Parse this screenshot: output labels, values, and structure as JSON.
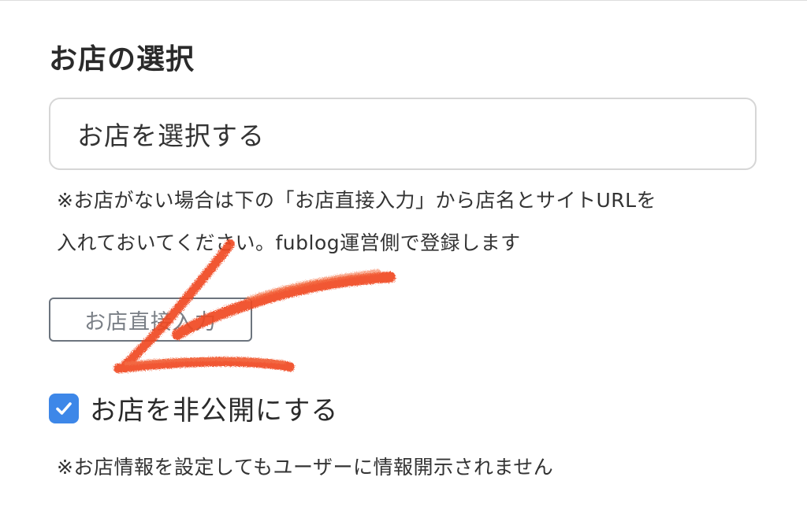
{
  "section": {
    "title": "お店の選択"
  },
  "shop_select": {
    "value": "お店を選択する"
  },
  "help": {
    "line1": "※お店がない場合は下の「お店直接入力」から店名とサイトURLを",
    "line2": "入れておいてください。fublog運営側で登録します"
  },
  "manual_entry": {
    "label": "お店直接入力"
  },
  "private_toggle": {
    "checked": true,
    "label": "お店を非公開にする"
  },
  "note": {
    "text": "※お店情報を設定してもユーザーに情報開示されません"
  },
  "annotation": {
    "type": "hand-drawn-arrow",
    "color": "#f04a24"
  },
  "colors": {
    "checkbox": "#3d87e8",
    "button_border": "#6c747e",
    "input_border": "#d6d6d6"
  }
}
